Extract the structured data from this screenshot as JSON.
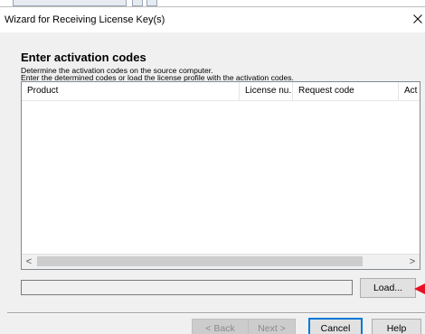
{
  "window": {
    "title": "Wizard for Receiving License Key(s)",
    "close_glyph": "✕"
  },
  "page": {
    "heading": "Enter activation codes",
    "description_line1": "Determine the activation codes on the source computer.",
    "description_line2": "Enter the determined codes or load the license profile with the activation codes."
  },
  "table": {
    "columns": [
      "Product",
      "License nu...",
      "Request code",
      "Act"
    ],
    "rows": []
  },
  "scrollbar": {
    "left_arrow": "<",
    "right_arrow": ">"
  },
  "file_path": {
    "value": ""
  },
  "buttons": {
    "load": "Load...",
    "back": "< Back",
    "next": "Next >",
    "cancel": "Cancel",
    "help": "Help"
  },
  "colors": {
    "accent": "#0078d7",
    "pointer_arrow": "#e81123",
    "dialog_bg": "#f0f0f0"
  },
  "icons": {
    "close": "close-icon",
    "pointer": "red-pointer-arrow-icon"
  }
}
